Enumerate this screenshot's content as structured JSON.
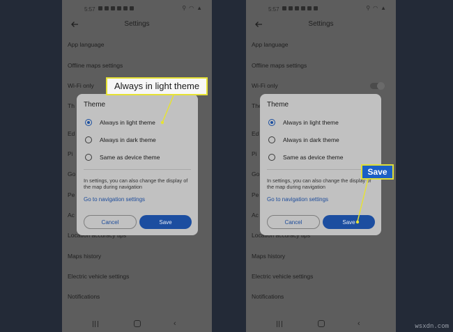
{
  "screens": [
    {
      "status": {
        "time": "5:57"
      },
      "app_bar": {
        "title": "Settings",
        "back_icon": "back-arrow-icon"
      },
      "settings_rows": [
        "App language",
        "Offline maps settings",
        "Wi-Fi only",
        "Th",
        "Ed",
        "Pi",
        "Go",
        "Pe",
        "Ac",
        "Location accuracy tips",
        "Maps history",
        "Electric vehicle settings",
        "Notifications"
      ],
      "dialog": {
        "title": "Theme",
        "options": [
          {
            "label": "Always in light theme",
            "selected": true
          },
          {
            "label": "Always in dark theme",
            "selected": false
          },
          {
            "label": "Same as device theme",
            "selected": false
          }
        ],
        "note": "In settings, you can also change the display of the map during navigation",
        "link": "Go to navigation settings",
        "cancel": "Cancel",
        "save": "Save"
      }
    },
    {
      "status": {
        "time": "5:57"
      },
      "app_bar": {
        "title": "Settings",
        "back_icon": "back-arrow-icon"
      },
      "settings_rows": [
        "App language",
        "Offline maps settings",
        "Wi-Fi only",
        "Theme",
        "Ed",
        "Pi",
        "Go",
        "Pe",
        "Ac",
        "Location accuracy tips",
        "Maps history",
        "Electric vehicle settings",
        "Notifications"
      ],
      "dialog": {
        "title": "Theme",
        "options": [
          {
            "label": "Always in light theme",
            "selected": true
          },
          {
            "label": "Always in dark theme",
            "selected": false
          },
          {
            "label": "Same as device theme",
            "selected": false
          }
        ],
        "note": "In settings, you can also change the display of the map during navigation",
        "link": "Go to navigation settings",
        "cancel": "Cancel",
        "save": "Save"
      }
    }
  ],
  "callouts": {
    "first": "Always in light theme",
    "second": "Save"
  },
  "watermark": "wsxdn.com",
  "colors": {
    "accent": "#1c4ea0",
    "callout_border": "#e6e234",
    "callout2_bg": "#1a5fc5"
  }
}
